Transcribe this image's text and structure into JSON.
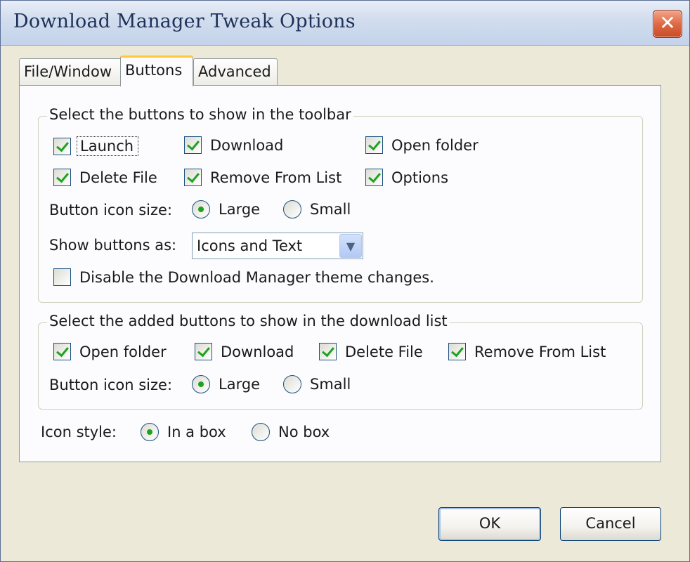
{
  "window": {
    "title": "Download Manager Tweak Options",
    "close_glyph": "✕"
  },
  "tabs": [
    {
      "label": "File/Window",
      "active": false
    },
    {
      "label": "Buttons",
      "active": true
    },
    {
      "label": "Advanced",
      "active": false
    }
  ],
  "toolbar_group": {
    "title": "Select the buttons to show in the toolbar",
    "checkboxes": [
      {
        "label": "Launch",
        "checked": true
      },
      {
        "label": "Download",
        "checked": true
      },
      {
        "label": "Open folder",
        "checked": true
      },
      {
        "label": "Delete File",
        "checked": true
      },
      {
        "label": "Remove From List",
        "checked": true
      },
      {
        "label": "Options",
        "checked": true
      }
    ],
    "icon_size_label": "Button icon size:",
    "icon_size_options": [
      {
        "label": "Large",
        "selected": true
      },
      {
        "label": "Small",
        "selected": false
      }
    ],
    "show_as_label": "Show buttons as:",
    "show_as_value": "Icons and Text",
    "disable_theme": {
      "label": "Disable the Download Manager theme changes.",
      "checked": false
    }
  },
  "list_group": {
    "title": "Select the added buttons to show in the download list",
    "checkboxes": [
      {
        "label": "Open folder",
        "checked": true
      },
      {
        "label": "Download",
        "checked": true
      },
      {
        "label": "Delete File",
        "checked": true
      },
      {
        "label": "Remove From List",
        "checked": true
      }
    ],
    "icon_size_label": "Button icon size:",
    "icon_size_options": [
      {
        "label": "Large",
        "selected": true
      },
      {
        "label": "Small",
        "selected": false
      }
    ]
  },
  "icon_style": {
    "label": "Icon style:",
    "options": [
      {
        "label": "In a box",
        "selected": true
      },
      {
        "label": "No box",
        "selected": false
      }
    ]
  },
  "buttons": {
    "ok": "OK",
    "cancel": "Cancel"
  },
  "colors": {
    "check_green": "#21a121",
    "tab_highlight": "#ffc83c",
    "close_red": "#e06a44"
  }
}
